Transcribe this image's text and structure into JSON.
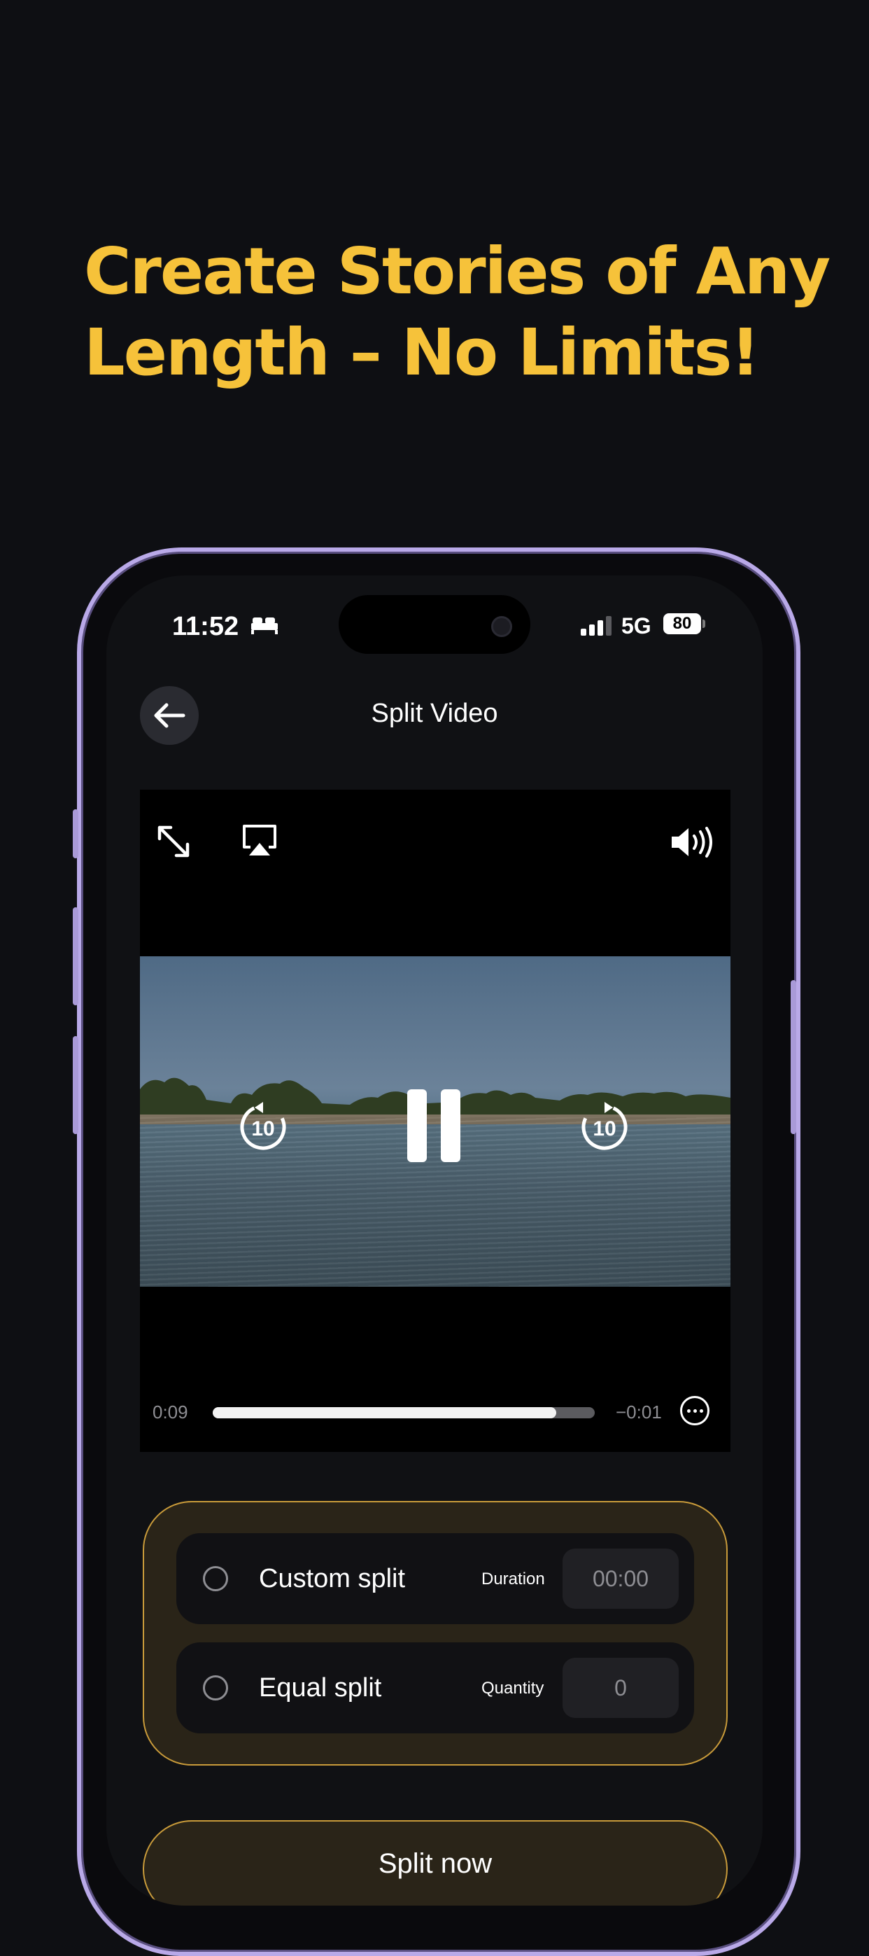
{
  "headline": {
    "line1": "Create Stories of Any",
    "line2": "Length – No Limits!"
  },
  "status_bar": {
    "time": "11:52",
    "network": "5G",
    "battery": "80"
  },
  "nav": {
    "title": "Split Video"
  },
  "player": {
    "elapsed": "0:09",
    "remaining": "−0:01",
    "progress": 0.9,
    "rewind_seconds": "10",
    "forward_seconds": "10"
  },
  "options": {
    "custom": {
      "label": "Custom split",
      "field_label": "Duration",
      "value": "00:00"
    },
    "equal": {
      "label": "Equal split",
      "field_label": "Quantity",
      "value": "0"
    }
  },
  "action": {
    "label": "Split now"
  },
  "colors": {
    "accent": "#f6c23a",
    "background": "#0e0f13",
    "frame": "#b9a9e8"
  }
}
